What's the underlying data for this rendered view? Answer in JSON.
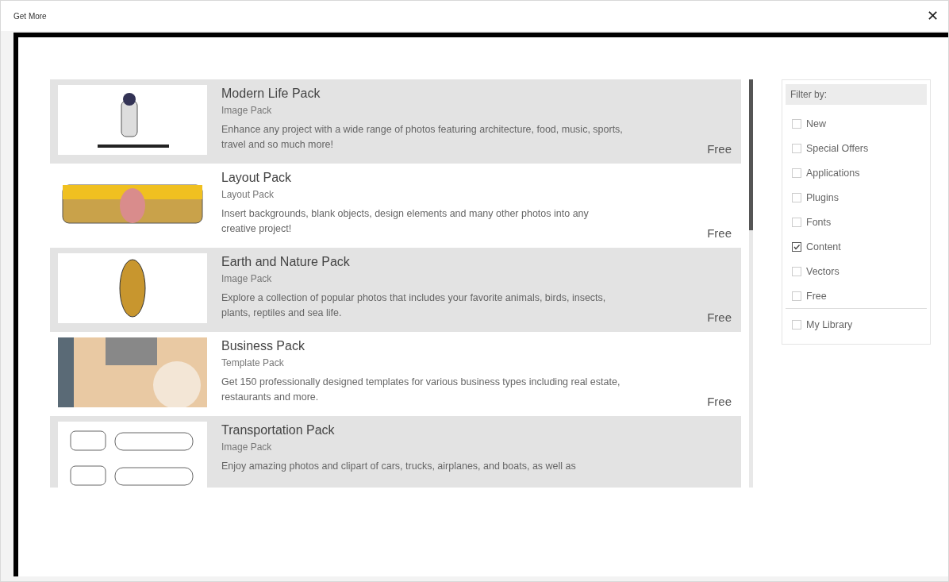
{
  "window": {
    "title": "Get More",
    "close": "✕"
  },
  "packs": [
    {
      "title": "Modern Life Pack",
      "type": "Image Pack",
      "description": "Enhance any project with a wide range of photos featuring architecture, food, music, sports, travel and so much more!",
      "price": "Free"
    },
    {
      "title": "Layout Pack",
      "type": "Layout Pack",
      "description": "Insert backgrounds, blank objects, design elements and many other photos into any creative project!",
      "price": "Free"
    },
    {
      "title": "Earth and Nature Pack",
      "type": "Image Pack",
      "description": "Explore a collection of popular photos that includes your favorite animals, birds, insects, plants, reptiles and sea life.",
      "price": "Free"
    },
    {
      "title": "Business Pack",
      "type": "Template Pack",
      "description": "Get 150 professionally designed templates for various business types including real estate, restaurants and more.",
      "price": "Free"
    },
    {
      "title": "Transportation Pack",
      "type": "Image Pack",
      "description": "Enjoy amazing photos and clipart of cars, trucks, airplanes, and boats, as well as"
    }
  ],
  "filter": {
    "heading": "Filter by:",
    "options": [
      {
        "label": "New",
        "checked": false
      },
      {
        "label": "Special Offers",
        "checked": false
      },
      {
        "label": "Applications",
        "checked": false
      },
      {
        "label": "Plugins",
        "checked": false
      },
      {
        "label": "Fonts",
        "checked": false
      },
      {
        "label": "Content",
        "checked": true
      },
      {
        "label": "Vectors",
        "checked": false
      },
      {
        "label": "Free",
        "checked": false
      }
    ],
    "library": [
      {
        "label": "My Library",
        "checked": false
      }
    ]
  }
}
